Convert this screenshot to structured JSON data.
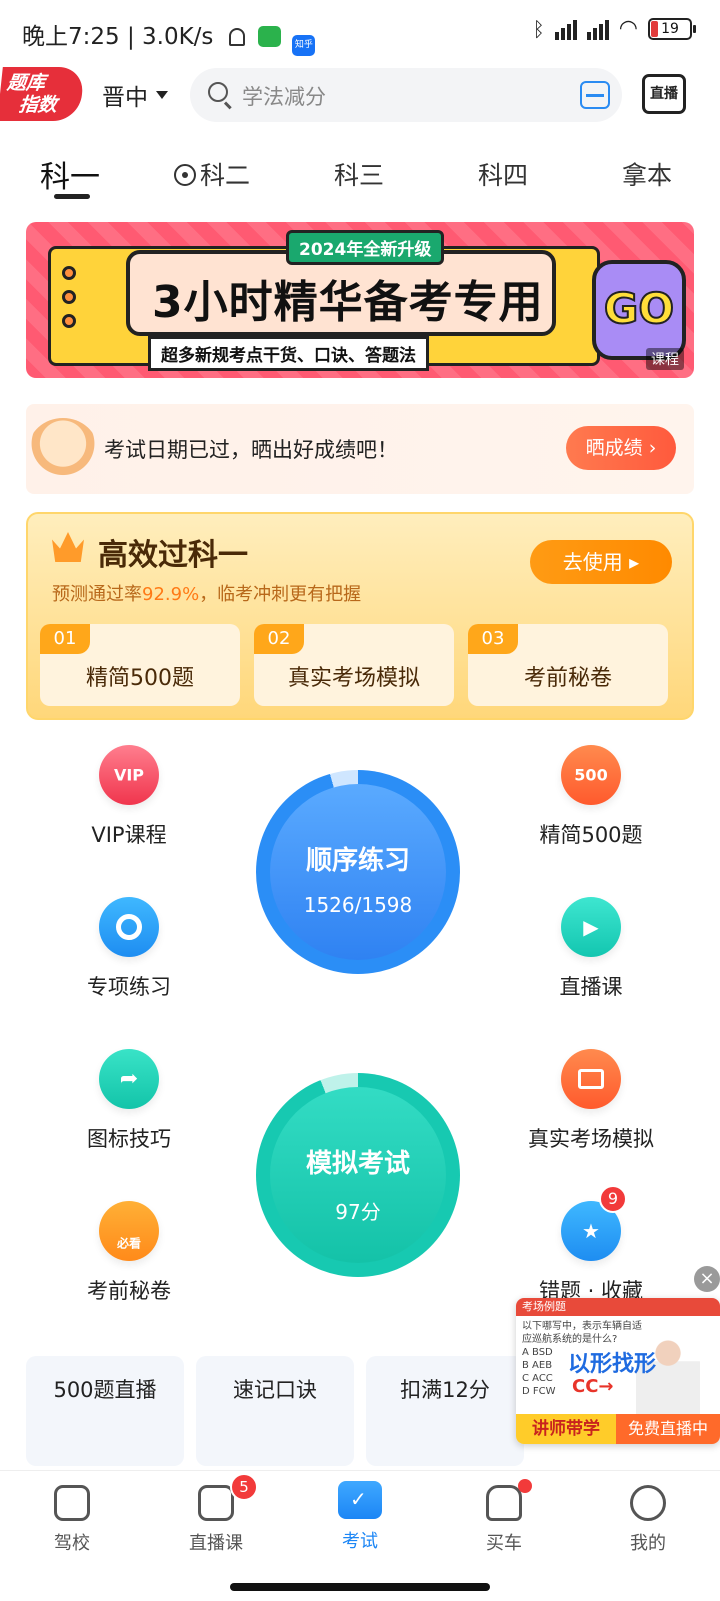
{
  "status_bar": {
    "time": "晚上7:25 | 3.0K/s",
    "battery": "19",
    "zhihu": "知乎"
  },
  "header": {
    "logo_line1": "题库",
    "logo_line2": "指数",
    "city": "晋中",
    "search_placeholder": "学法减分",
    "live_button": "直播"
  },
  "tabs": [
    "科一",
    "科二",
    "科三",
    "科四",
    "拿本"
  ],
  "banner": {
    "tag": "2024年全新升级",
    "headline": "3小时精华备考专用",
    "sub": "超多新规考点干货、口诀、答题法",
    "go": "GO",
    "label": "课程"
  },
  "result_card": {
    "text": "考试日期已过，晒出好成绩吧！",
    "button": "晒成绩 ›"
  },
  "pass_section": {
    "title": "高效过科一",
    "subtitle_prefix": "预测通过率",
    "subtitle_rate": "92.9%",
    "subtitle_suffix": "，临考冲刺更有把握",
    "use_button": "去使用 ▸",
    "cards": [
      {
        "no": "01",
        "label": "精简500题"
      },
      {
        "no": "02",
        "label": "真实考场模拟"
      },
      {
        "no": "03",
        "label": "考前秘卷"
      }
    ]
  },
  "features": {
    "vip": {
      "label": "VIP课程",
      "icon": "VIP"
    },
    "jj500": {
      "label": "精简500题",
      "icon": "500"
    },
    "zx": {
      "label": "专项练习"
    },
    "live": {
      "label": "直播课"
    },
    "tb": {
      "label": "图标技巧"
    },
    "real": {
      "label": "真实考场模拟"
    },
    "mj": {
      "label": "考前秘卷",
      "icon": "必看"
    },
    "err": {
      "label": "错题 · 收藏",
      "badge": "9"
    }
  },
  "circles": {
    "order": {
      "title": "顺序练习",
      "value": "1526/1598",
      "progress": 0.955
    },
    "mock": {
      "title": "模拟考试",
      "value": "97分"
    }
  },
  "bottom_cards": [
    "500题直播",
    "速记口诀",
    "扣满12分"
  ],
  "float_video": {
    "header": "考场例题",
    "question": "以下哪写中，表示车辆自适应巡航系统的是什么?",
    "options": [
      "A BSD",
      "B AEB",
      "C ACC",
      "D FCW"
    ],
    "big": "以形找形",
    "cc": "CC→",
    "left_tag": "讲师带学",
    "right_tag": "免费直播中"
  },
  "bottom_nav": [
    {
      "label": "驾校"
    },
    {
      "label": "直播课",
      "badge": "5"
    },
    {
      "label": "考试"
    },
    {
      "label": "买车"
    },
    {
      "label": "我的"
    }
  ]
}
